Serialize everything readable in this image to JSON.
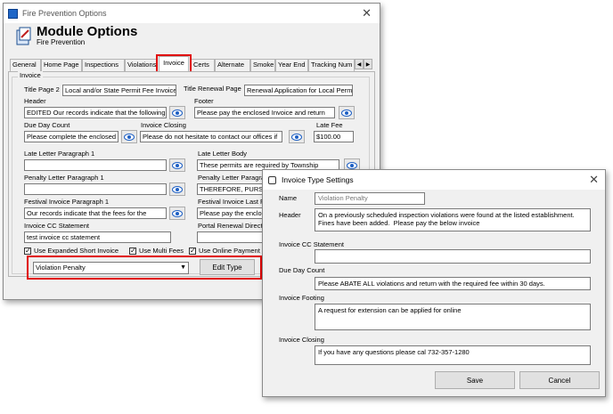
{
  "main_window": {
    "title": "Fire Prevention Options",
    "header": "Module Options",
    "subheader": "Fire Prevention",
    "tabs": [
      "General",
      "Home Page",
      "Inspections",
      "Violations",
      "Invoice",
      "Certs",
      "Alternate",
      "Smoke",
      "Year End",
      "Tracking Num"
    ],
    "active_tab": "Invoice",
    "group_label": "Invoice",
    "fields": {
      "title_page2_label": "Title Page 2",
      "title_page2_value": "Local and/or State Permit Fee Invoice",
      "title_renewal_label": "Title Renewal Page",
      "title_renewal_value": "Renewal Application for Local Permit",
      "header_label": "Header",
      "header_value": "EDITED Our records indicate that the following",
      "footer_label": "Footer",
      "footer_value": "Please pay the enclosed Invoice and return",
      "due_day_label": "Due Day Count",
      "due_day_value": "Please complete the enclosed a",
      "invoice_closing_label": "Invoice Closing",
      "invoice_closing_value": "Please do not hesitate to contact our offices if",
      "late_fee_label": "Late Fee",
      "late_fee_value": "$100.00",
      "late_letter_p1_label": "Late Letter Paragraph 1",
      "late_letter_p1_value": "",
      "late_letter_body_label": "Late Letter Body",
      "late_letter_body_value": "These permits are required by Township",
      "penalty_p1_label": "Penalty Letter Paragraph 1",
      "penalty_p1_value": "",
      "penalty_p2_label": "Penalty Letter Paragra",
      "penalty_p2_value": "THEREFORE, PURSU",
      "festival_p1_label": "Festival Invoice Paragraph 1",
      "festival_p1_value": "Our records indicate that the fees for the",
      "festival_last_label": "Festival Invoice Last F",
      "festival_last_value": "Please pay the enclo",
      "cc_statement_label": "Invoice CC Statement",
      "cc_statement_value": "test invoice cc statement",
      "portal_label": "Portal Renewal Direct",
      "portal_value": ""
    },
    "checkboxes": [
      {
        "label": "Use Expanded Short Invoice",
        "checked": true
      },
      {
        "label": "Use Multi Fees",
        "checked": true
      },
      {
        "label": "Use Online Payment",
        "checked": true
      }
    ],
    "type_select": "Violation Penalty",
    "edit_type_button": "Edit Type",
    "highlight_color": "#e00000"
  },
  "dialog": {
    "title": "Invoice Type Settings",
    "name_label": "Name",
    "name_value": "Violation Penalty",
    "header_label": "Header",
    "header_value": "On a previously scheduled inspection violations were found at the listed establishment.\nFines have been added.  Please pay the below invoice",
    "cc_label": "Invoice CC Statement",
    "cc_value": "",
    "due_label": "Due Day Count",
    "due_value": "Please ABATE ALL violations and return with the required fee within 30 days.",
    "footing_label": "Invoice Footing",
    "footing_value": "A request for extension can be applied for online",
    "closing_label": "Invoice Closing",
    "closing_value": "If you have any questions please cal 732-357-1280",
    "save_button": "Save",
    "cancel_button": "Cancel"
  }
}
